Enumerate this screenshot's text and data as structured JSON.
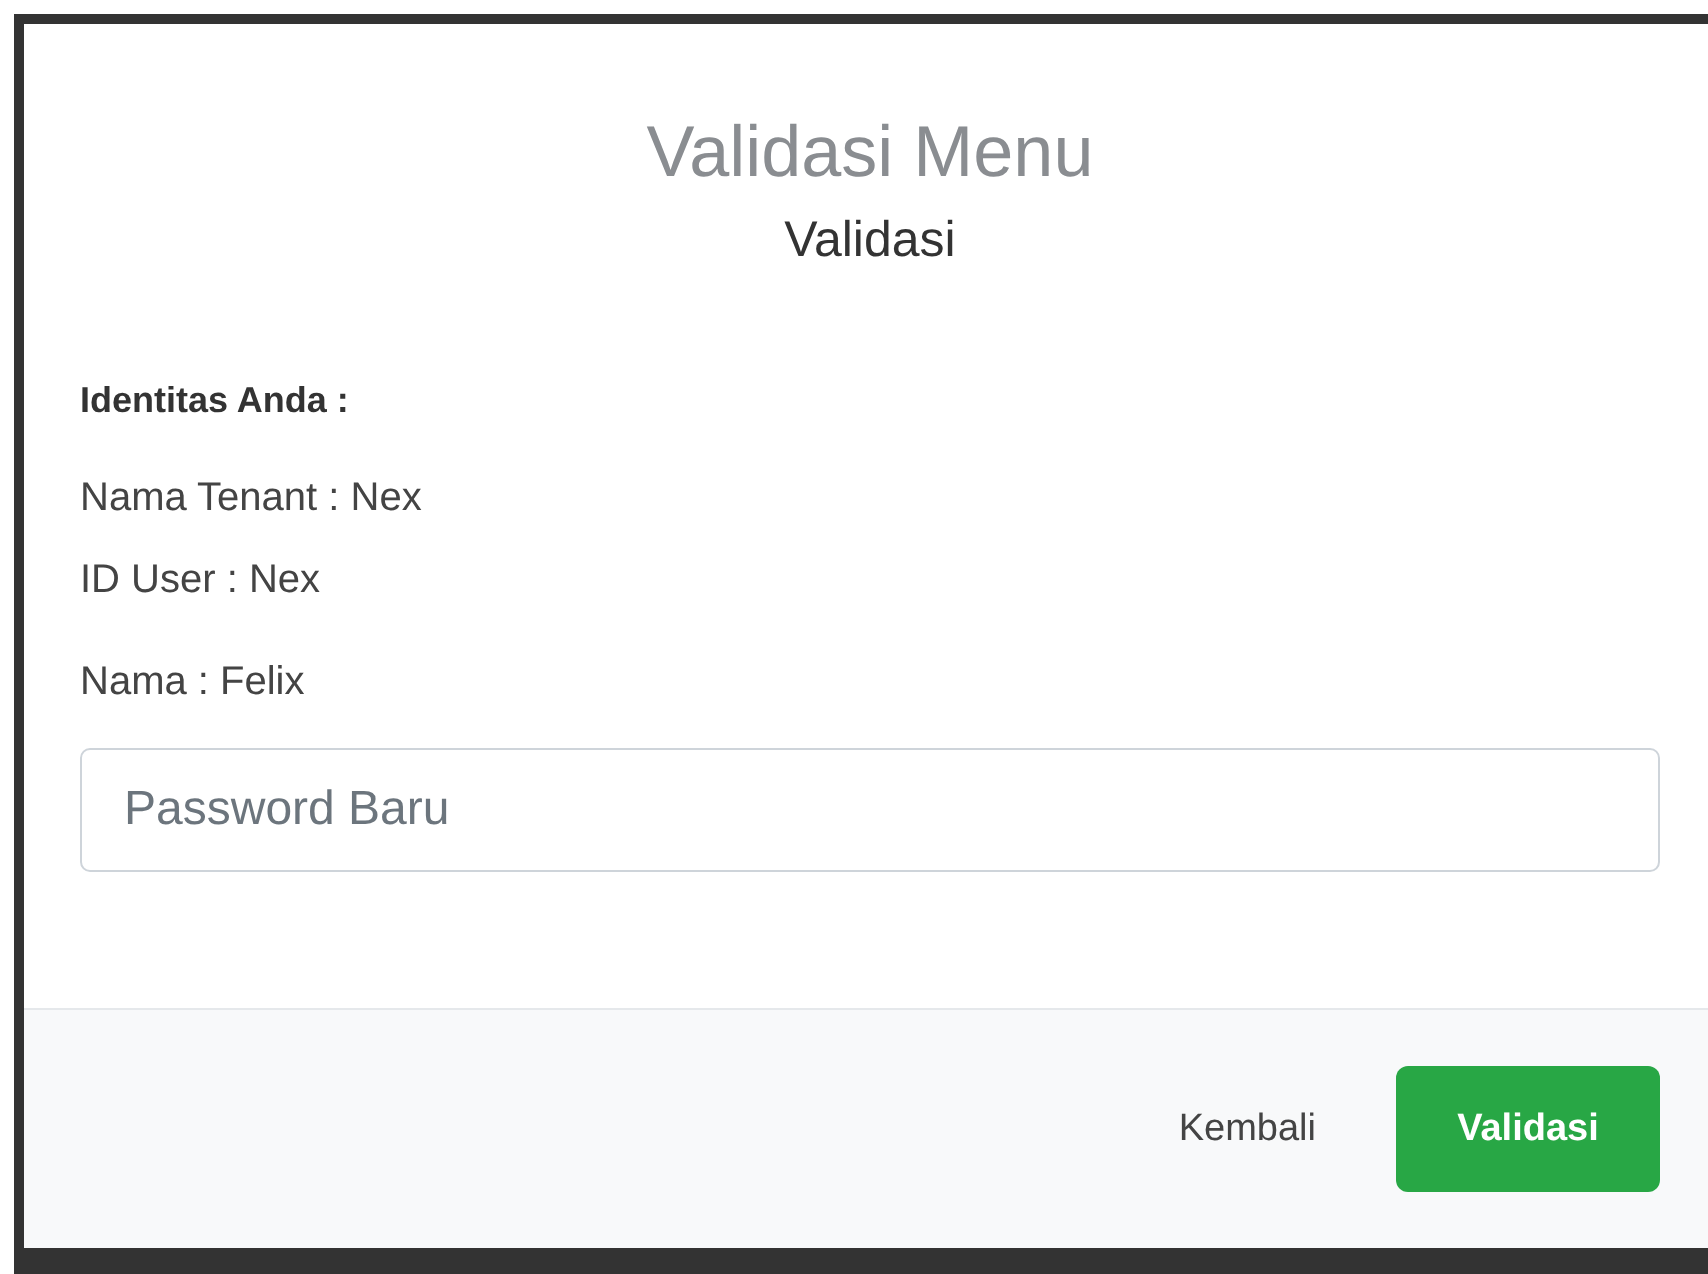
{
  "modal": {
    "title": "Validasi Menu",
    "subtitle": "Validasi",
    "identity_heading": "Identitas Anda :",
    "identity_lines": [
      "Nama Tenant : Nex",
      "ID User : Nex"
    ],
    "name_line": "Nama : Felix",
    "password_field": {
      "placeholder": "Password Baru"
    },
    "buttons": [
      {
        "label": "Kembali",
        "kind": "link"
      },
      {
        "label": "Validasi",
        "kind": "primary"
      }
    ]
  }
}
